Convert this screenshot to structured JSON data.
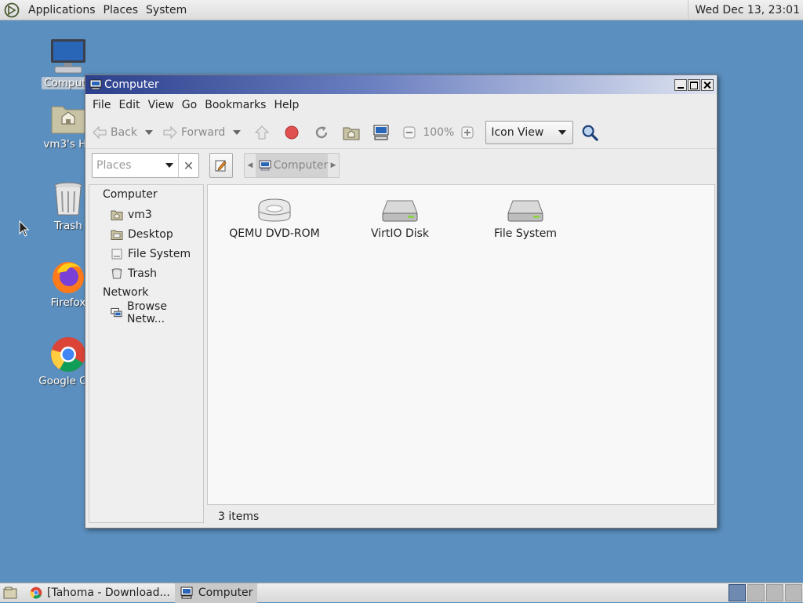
{
  "top_panel": {
    "menus": [
      "Applications",
      "Places",
      "System"
    ],
    "clock": "Wed Dec 13, 23:01"
  },
  "desktop_icons": [
    {
      "label": "Compute",
      "icon": "computer-icon",
      "selected": true
    },
    {
      "label": "vm3's Ho",
      "icon": "home-folder-icon"
    },
    {
      "label": "Trash",
      "icon": "trash-icon"
    },
    {
      "label": "Firefox",
      "icon": "firefox-icon"
    },
    {
      "label": "Google Chr",
      "icon": "chrome-icon"
    }
  ],
  "window": {
    "title": "Computer",
    "menubar": [
      "File",
      "Edit",
      "View",
      "Go",
      "Bookmarks",
      "Help"
    ],
    "toolbar": {
      "back": "Back",
      "forward": "Forward",
      "zoom": "100%",
      "view_mode": "Icon View"
    },
    "location": {
      "places_placeholder": "Places",
      "crumb": "Computer"
    },
    "sidebar": {
      "computer_header": "Computer",
      "computer_items": [
        "vm3",
        "Desktop",
        "File System",
        "Trash"
      ],
      "network_header": "Network",
      "network_items": [
        "Browse Netw..."
      ]
    },
    "items": [
      {
        "label": "QEMU DVD-ROM",
        "icon": "optical-drive-icon"
      },
      {
        "label": "VirtIO Disk",
        "icon": "hard-disk-icon"
      },
      {
        "label": "File System",
        "icon": "hard-disk-icon"
      }
    ],
    "status": "3 items"
  },
  "taskbar": {
    "tasks": [
      "[Tahoma - Download...",
      "Computer"
    ]
  },
  "colors": {
    "desktop": "#5b8fbf",
    "titlebar_start": "#2c3f8c"
  }
}
